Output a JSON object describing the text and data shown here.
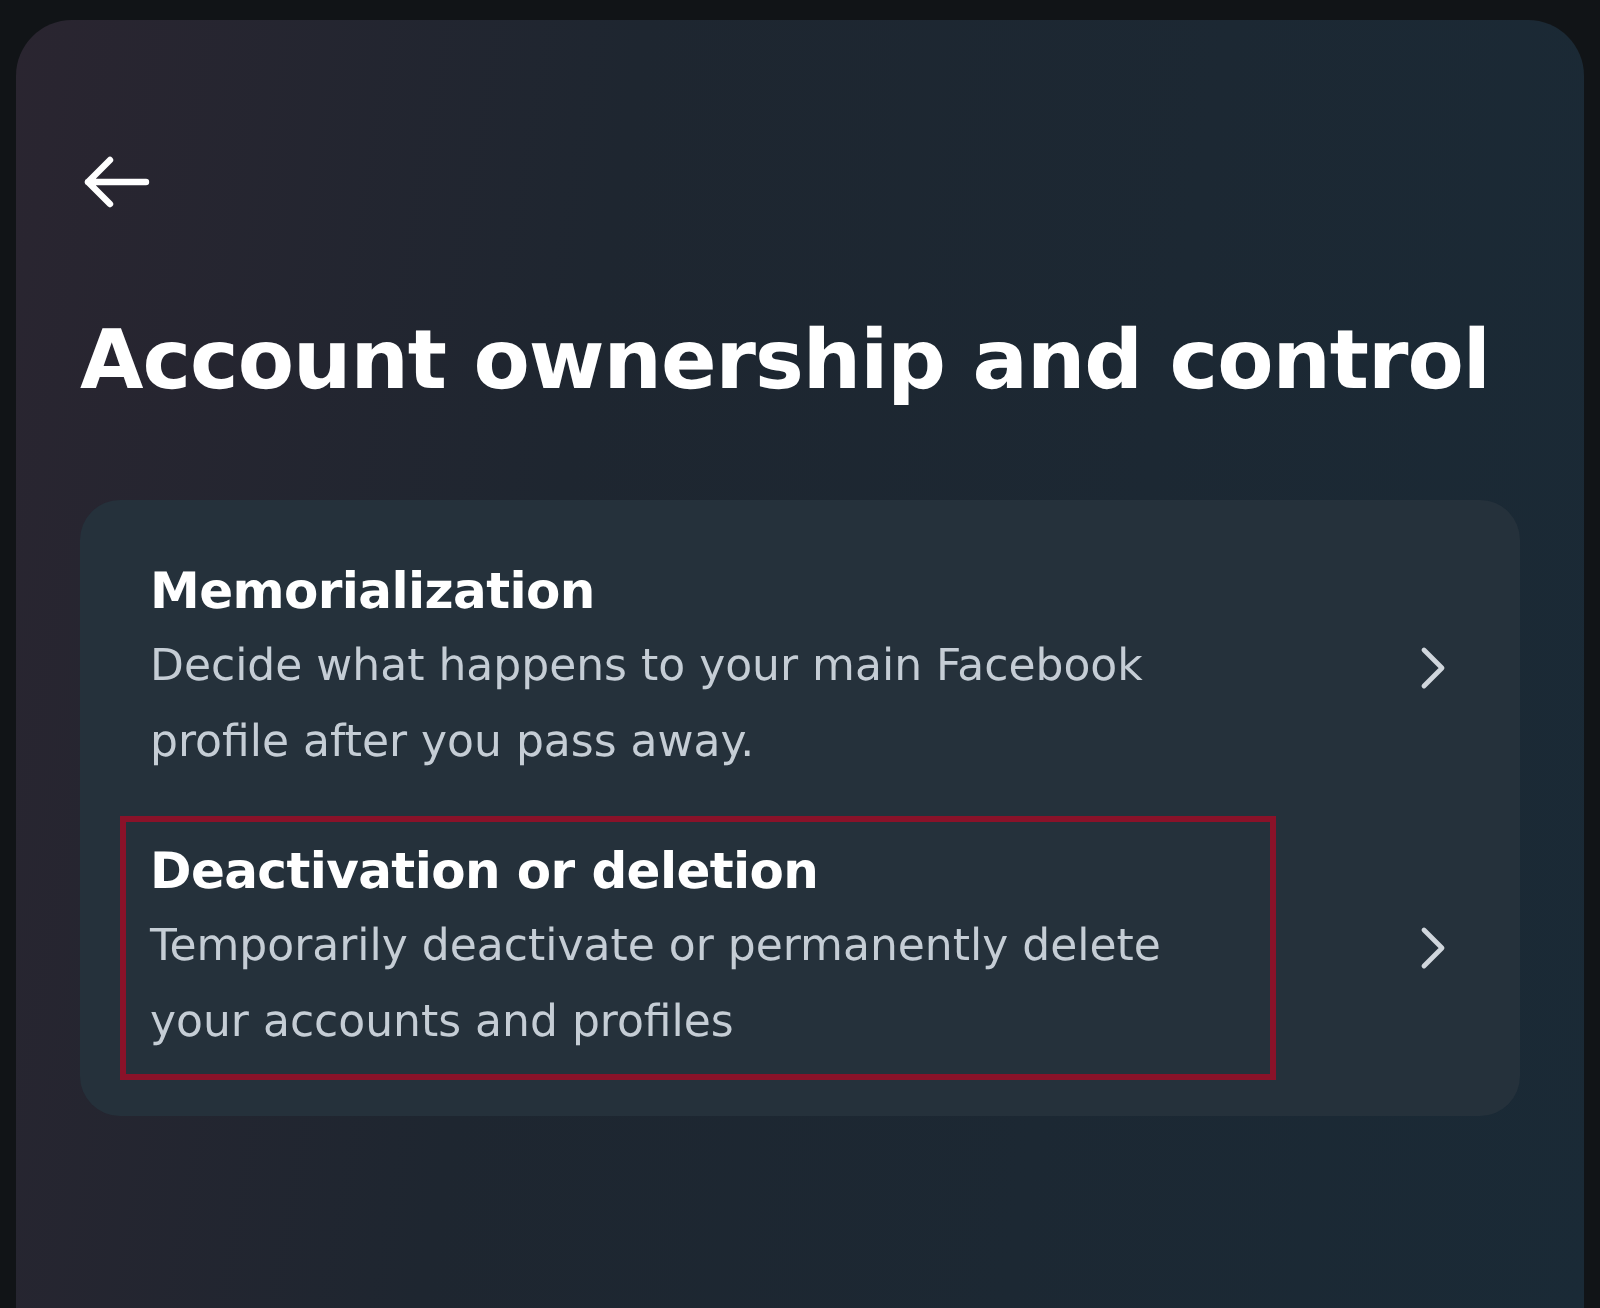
{
  "header": {
    "title": "Account ownership and control"
  },
  "options": [
    {
      "title": "Memorialization",
      "description": "Decide what happens to your main Facebook profile after you pass away.",
      "highlighted": false
    },
    {
      "title": "Deactivation or deletion",
      "description": "Temporarily deactivate or permanently delete your accounts and profiles",
      "highlighted": true
    }
  ]
}
